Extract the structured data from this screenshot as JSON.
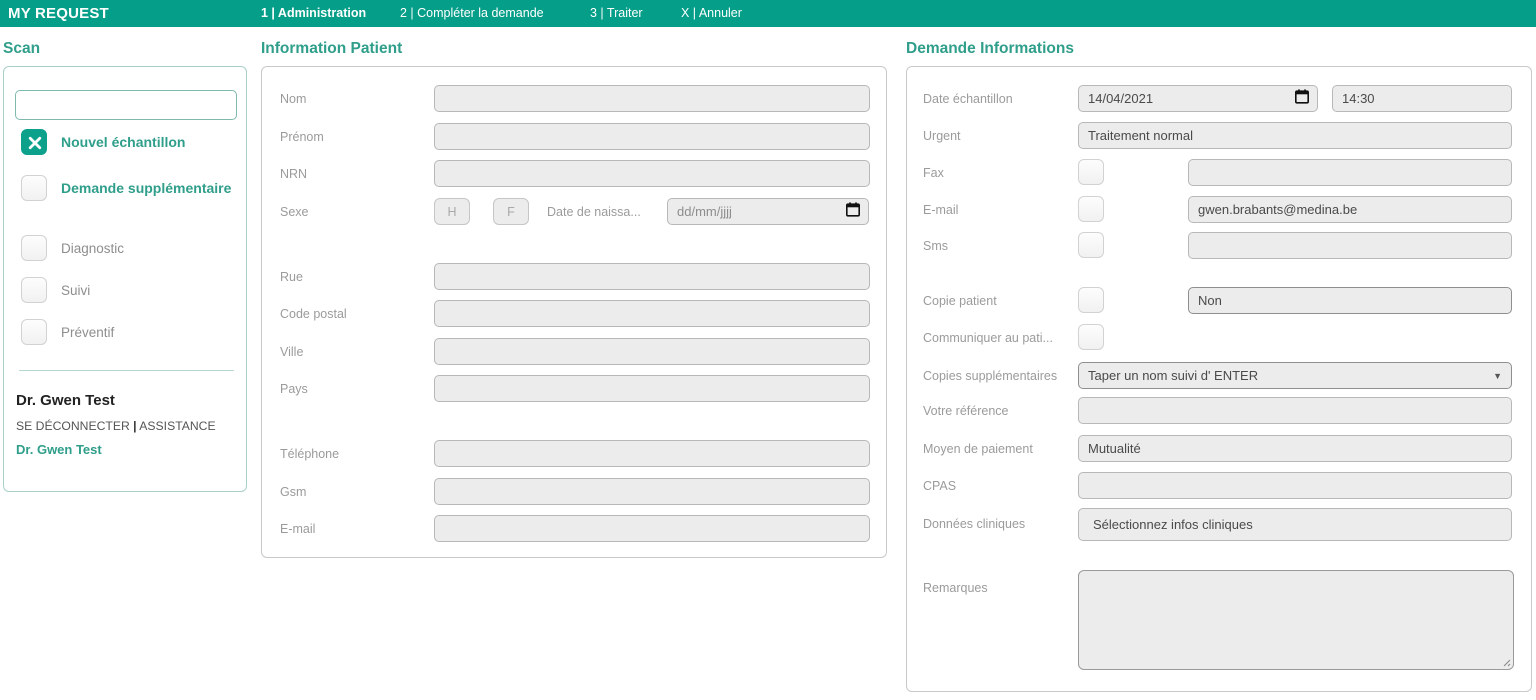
{
  "topbar": {
    "brand": "MY REQUEST",
    "accent_color": "#059e89",
    "tabs": [
      {
        "label": "1 | Administration",
        "active": true
      },
      {
        "label": "2 | Compléter la demande",
        "active": false
      },
      {
        "label": "3 | Traiter",
        "active": false
      },
      {
        "label": "X | Annuler",
        "active": false
      }
    ]
  },
  "scan": {
    "title": "Scan",
    "input_value": "",
    "input_placeholder": "",
    "options": [
      {
        "label": "Nouvel échantillon",
        "checked": true,
        "emphasis": true
      },
      {
        "label": "Demande supplémentaire",
        "checked": false,
        "emphasis": true
      },
      {
        "label": "Diagnostic",
        "checked": false,
        "emphasis": false
      },
      {
        "label": "Suivi",
        "checked": false,
        "emphasis": false
      },
      {
        "label": "Préventif",
        "checked": false,
        "emphasis": false
      }
    ],
    "user": {
      "name": "Dr. Gwen Test",
      "logout_label": "SE DÉCONNECTER",
      "separator": "|",
      "assistance_label": "ASSISTANCE",
      "links_line": "SE DÉCONNECTER | ASSISTANCE",
      "account_label": "Dr. Gwen Test"
    }
  },
  "patient": {
    "title": "Information Patient",
    "fields": {
      "nom": {
        "label": "Nom",
        "value": ""
      },
      "prenom": {
        "label": "Prénom",
        "value": ""
      },
      "nrn": {
        "label": "NRN",
        "value": ""
      },
      "sexe": {
        "label": "Sexe",
        "male_label": "H",
        "female_label": "F"
      },
      "date_naissance": {
        "label": "Date de naissa...",
        "value": "",
        "placeholder": "dd/mm/jjjj"
      },
      "rue": {
        "label": "Rue",
        "value": ""
      },
      "code_postal": {
        "label": "Code postal",
        "value": ""
      },
      "ville": {
        "label": "Ville",
        "value": ""
      },
      "pays": {
        "label": "Pays",
        "value": ""
      },
      "telephone": {
        "label": "Téléphone",
        "value": ""
      },
      "gsm": {
        "label": "Gsm",
        "value": ""
      },
      "email": {
        "label": "E-mail",
        "value": ""
      }
    }
  },
  "demande": {
    "title": "Demande Informations",
    "fields": {
      "date_echantillon": {
        "label": "Date échantillon",
        "date_value": "14/04/2021",
        "time_value": "14:30"
      },
      "urgent": {
        "label": "Urgent",
        "value": "Traitement normal"
      },
      "fax": {
        "label": "Fax",
        "checked": false,
        "value": ""
      },
      "email": {
        "label": "E-mail",
        "checked": false,
        "value": "gwen.brabants@medina.be"
      },
      "sms": {
        "label": "Sms",
        "checked": false,
        "value": ""
      },
      "copie_patient": {
        "label": "Copie patient",
        "checked": false,
        "value": "Non"
      },
      "communiquer_patient": {
        "label": "Communiquer au pati...",
        "checked": false
      },
      "copies_supplementaires": {
        "label": "Copies supplémentaires",
        "value": "Taper un nom suivi d' ENTER"
      },
      "votre_reference": {
        "label": "Votre référence",
        "value": ""
      },
      "moyen_paiement": {
        "label": "Moyen de paiement",
        "value": "Mutualité"
      },
      "cpas": {
        "label": "CPAS",
        "value": ""
      },
      "donnees_cliniques": {
        "label": "Données cliniques",
        "value": "Sélectionnez infos cliniques"
      },
      "remarques": {
        "label": "Remarques",
        "value": ""
      }
    }
  }
}
